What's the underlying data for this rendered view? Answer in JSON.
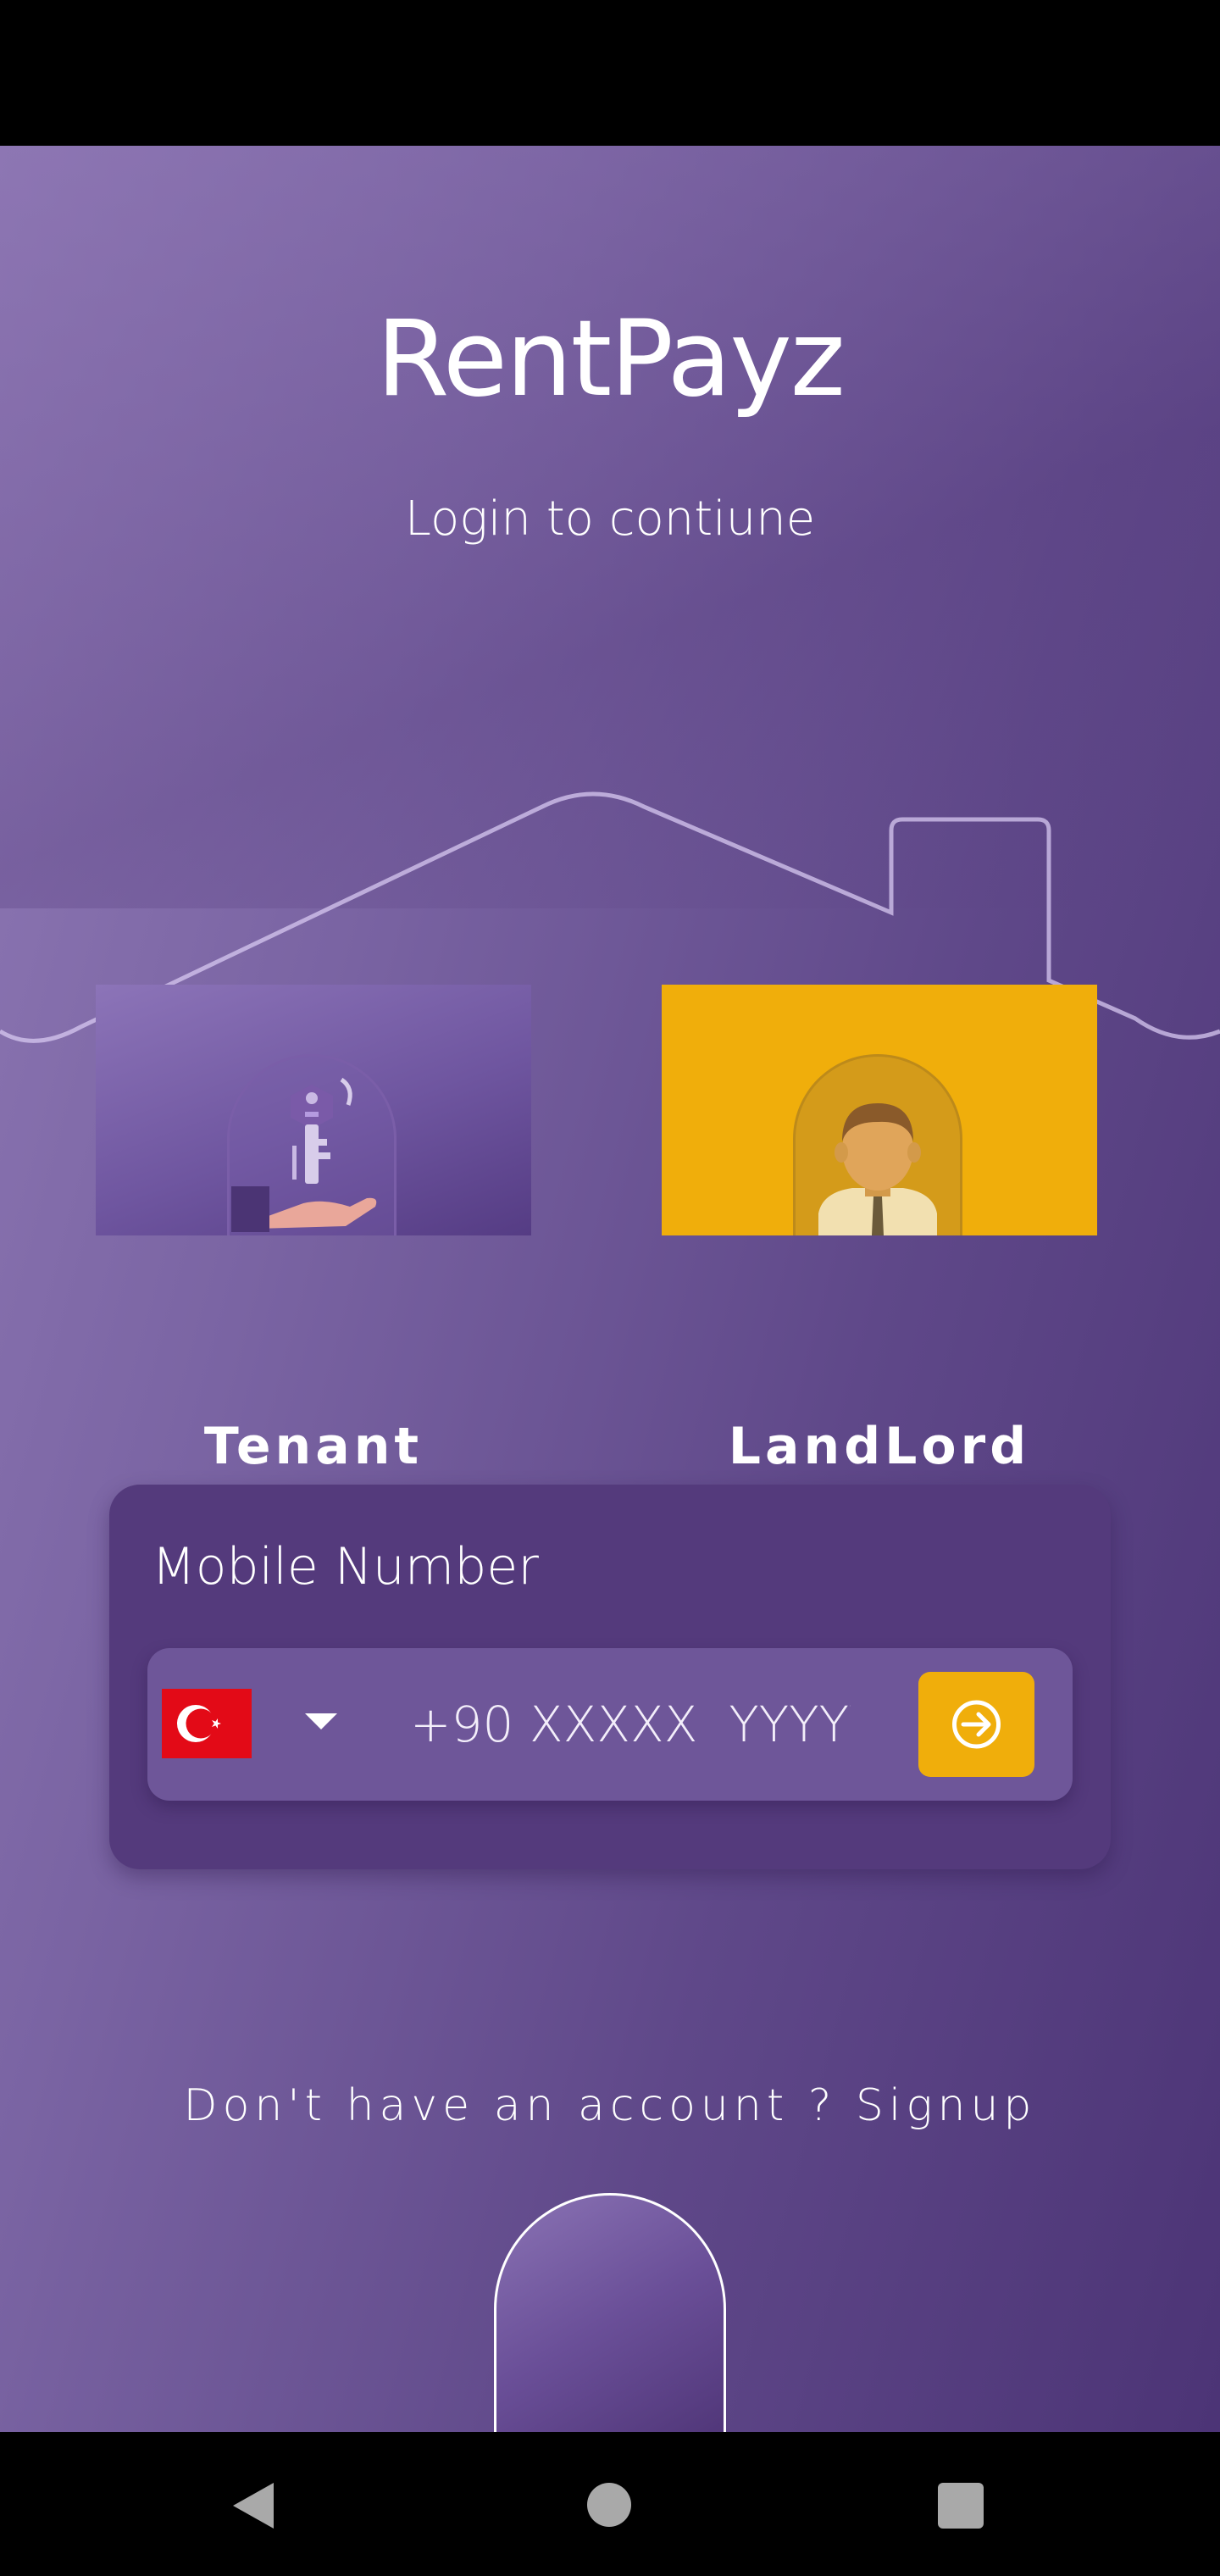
{
  "app": {
    "title": "RentPayz",
    "subtitle": "Login to contiune"
  },
  "roles": [
    {
      "label": "Tenant",
      "icon": "key-in-hand-icon",
      "selected": false
    },
    {
      "label": "LandLord",
      "icon": "landlord-person-icon",
      "selected": true
    }
  ],
  "login": {
    "mobile_label": "Mobile Number",
    "country_flag": "turkey-flag-icon",
    "phone_placeholder": "+90 XXXXX  YYYYY",
    "submit_icon": "arrow-right-circle-icon"
  },
  "signup_prompt": "Don't have an account ? Signup",
  "nav": {
    "back": "back-icon",
    "home": "home-icon",
    "recents": "recents-icon"
  },
  "colors": {
    "accent": "#f0ae0b",
    "primary_dark": "#543a7c",
    "primary_light": "#8f79b5"
  }
}
